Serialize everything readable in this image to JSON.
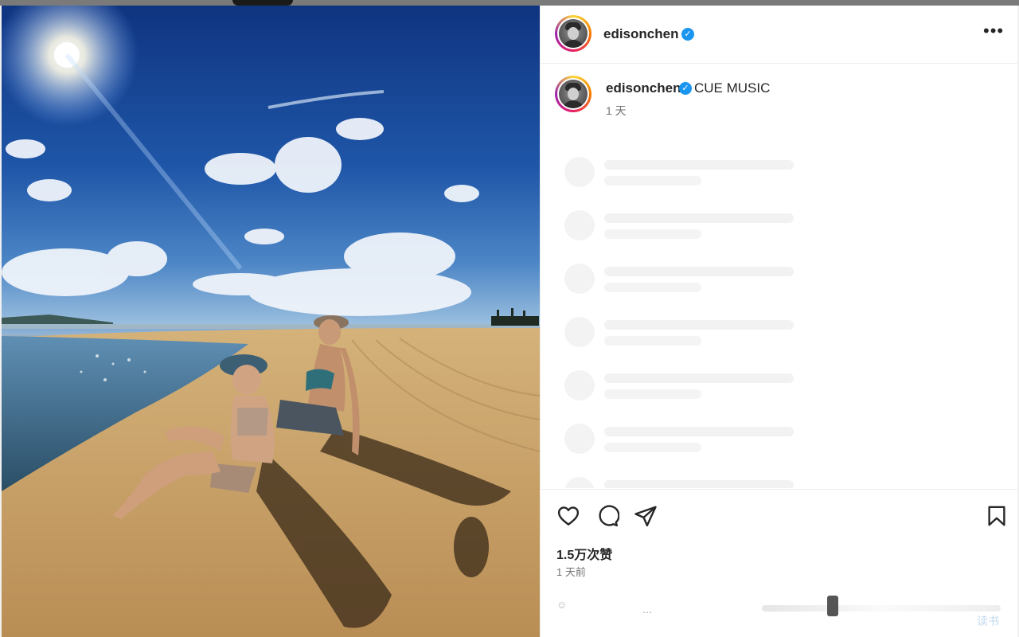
{
  "header": {
    "username": "edisonchen",
    "verified": true,
    "more_icon": "more-horizontal-icon"
  },
  "caption": {
    "username": "edisonchen",
    "verified": true,
    "text": "CUE MUSIC",
    "time": "1 天"
  },
  "comments": {
    "loading": true
  },
  "actions": {
    "icons": [
      "heart-icon",
      "comment-icon",
      "share-icon",
      "bookmark-icon"
    ]
  },
  "stats": {
    "likes": "1.5万次赞",
    "posted": "1 天前"
  },
  "photo": {
    "subject": "beach"
  },
  "watermark": {
    "text": "读书"
  },
  "colors": {
    "verified_blue": "#1a95f0",
    "text_primary": "#262626",
    "text_secondary": "#737373"
  }
}
